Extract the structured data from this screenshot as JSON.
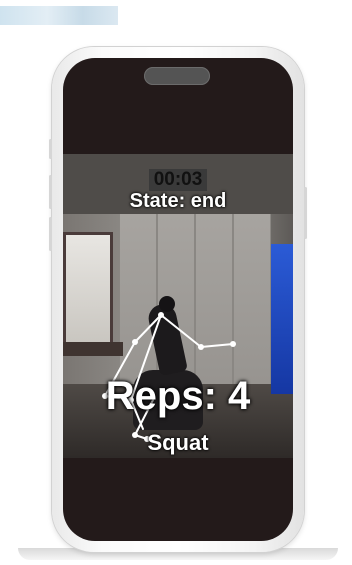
{
  "overlay": {
    "timer": "00:03",
    "state_label": "State: end",
    "reps_label": "Reps: 4",
    "exercise_label": "Squat"
  },
  "colors": {
    "screen_background": "#231a1a",
    "overlay_text": "#ffffff",
    "skeleton": "#ffffff"
  }
}
